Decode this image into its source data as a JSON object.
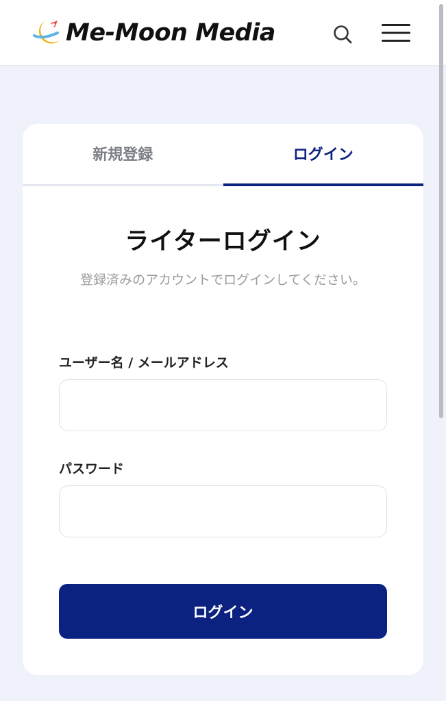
{
  "header": {
    "logo_text": "Me-Moon Media",
    "search_icon": "search-icon",
    "menu_icon": "hamburger-menu-icon"
  },
  "tabs": [
    {
      "label": "新規登録",
      "active": false
    },
    {
      "label": "ログイン",
      "active": true
    }
  ],
  "form": {
    "title": "ライターログイン",
    "subtitle": "登録済みのアカウントでログインしてください。",
    "username_label": "ユーザー名 / メールアドレス",
    "username_value": "",
    "password_label": "パスワード",
    "password_value": "",
    "submit_label": "ログイン"
  },
  "colors": {
    "accent": "#0c2280",
    "background": "#eff2fa",
    "inactive_tab": "#7c7f86"
  }
}
